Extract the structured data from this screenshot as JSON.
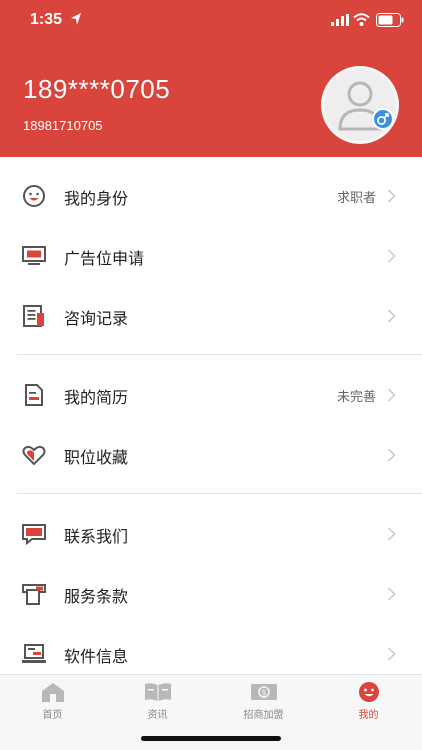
{
  "status_bar": {
    "time": "1:35"
  },
  "profile": {
    "masked_phone": "189****0705",
    "phone": "18981710705"
  },
  "colors": {
    "primary": "#d9443d",
    "badge_blue": "#3f8fe0"
  },
  "menu": {
    "identity": {
      "label": "我的身份",
      "value": "求职者",
      "icon": "face-icon"
    },
    "ad_apply": {
      "label": "广告位申请",
      "icon": "monitor-icon"
    },
    "consult_records": {
      "label": "咨询记录",
      "icon": "records-icon"
    },
    "resume": {
      "label": "我的简历",
      "value": "未完善",
      "icon": "document-icon"
    },
    "favorites": {
      "label": "职位收藏",
      "icon": "heart-icon"
    },
    "contact": {
      "label": "联系我们",
      "icon": "chat-icon"
    },
    "terms": {
      "label": "服务条款",
      "icon": "terms-icon"
    },
    "software_info": {
      "label": "软件信息",
      "icon": "laptop-icon"
    }
  },
  "tabs": [
    {
      "label": "首页",
      "icon": "home-icon"
    },
    {
      "label": "资讯",
      "icon": "news-icon"
    },
    {
      "label": "招商加盟",
      "icon": "money-icon"
    },
    {
      "label": "我的",
      "icon": "profile-face-icon",
      "active": true
    }
  ]
}
